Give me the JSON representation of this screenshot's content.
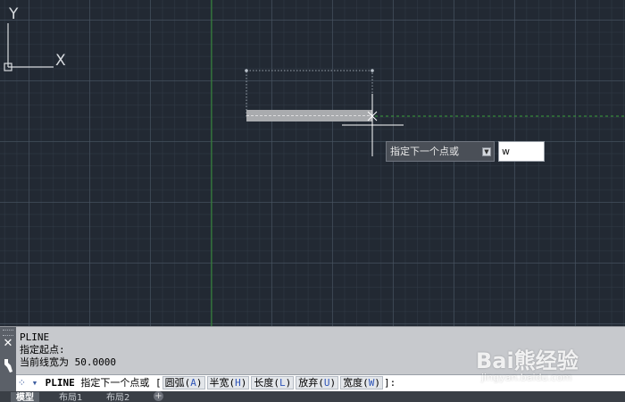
{
  "dynamic_input": {
    "prompt": "指定下一个点或",
    "value": "w",
    "dropdown_icon": "arrow-down-icon"
  },
  "ucs": {
    "x_label": "X",
    "y_label": "Y"
  },
  "command_window": {
    "history": [
      "PLINE",
      "指定起点:",
      "当前线宽为 50.0000"
    ],
    "prompt_icon": "command-prompt-icon",
    "command": "PLINE",
    "prompt_text": "指定下一个点或 [",
    "options": [
      {
        "label": "圆弧(",
        "key": "A",
        "close": ")"
      },
      {
        "label": "半宽(",
        "key": "H",
        "close": ")"
      },
      {
        "label": "长度(",
        "key": "L",
        "close": ")"
      },
      {
        "label": "放弃(",
        "key": "U",
        "close": ")"
      },
      {
        "label": "宽度(",
        "key": "W",
        "close": ")"
      }
    ],
    "suffix": "]:"
  },
  "layout_tabs": [
    "模型",
    "布局1",
    "布局2"
  ],
  "watermark": {
    "text": "Bai熊经验",
    "sub": "jingyan.baidu.com"
  },
  "colors": {
    "canvas_bg": "#222933",
    "grid_major": "#4a5664",
    "axis_green": "#2f8a2f",
    "polyline_fill": "#a9abae",
    "crosshair": "#ffffff"
  }
}
